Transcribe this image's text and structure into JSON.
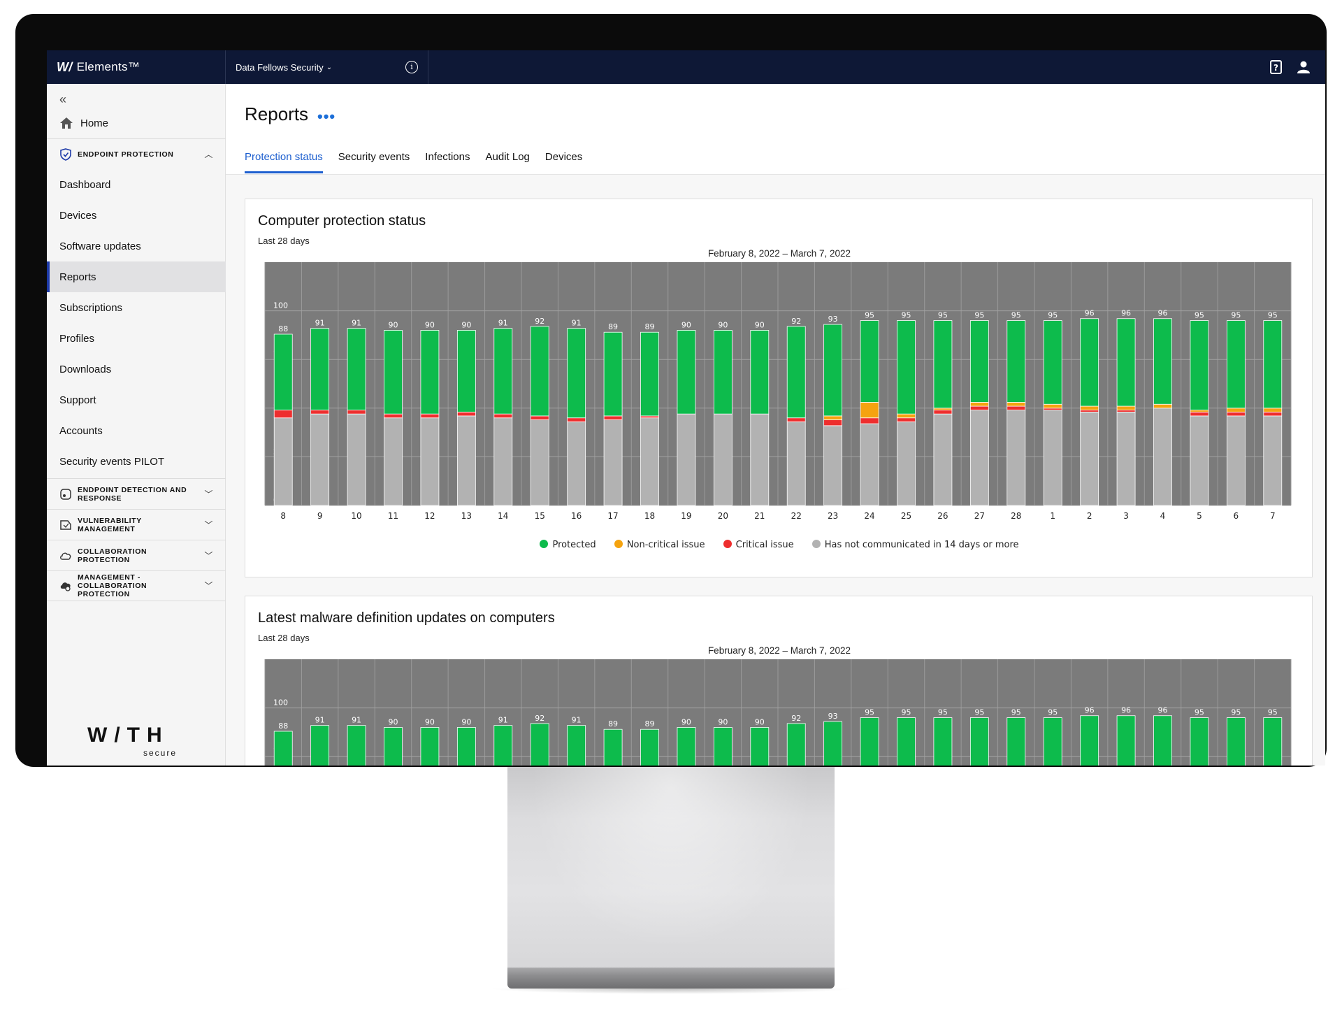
{
  "topbar": {
    "brand": "Elements™",
    "brand_mark": "W/",
    "org": "Data Fellows Security",
    "org_chevron": "⌄",
    "info": "i"
  },
  "sidebar": {
    "collapse": "«",
    "home": "Home",
    "endpoint_protection": "ENDPOINT PROTECTION",
    "items": [
      "Dashboard",
      "Devices",
      "Software updates",
      "Reports",
      "Subscriptions",
      "Profiles",
      "Downloads",
      "Support",
      "Accounts",
      "Security events PILOT"
    ],
    "sections": [
      "ENDPOINT DETECTION AND RESPONSE",
      "VULNERABILITY MANAGEMENT",
      "COLLABORATION PROTECTION",
      "MANAGEMENT - COLLABORATION PROTECTION"
    ],
    "logo": "W/TH",
    "logo_sub": "secure"
  },
  "main": {
    "title": "Reports",
    "more": "•••",
    "tabs": [
      "Protection status",
      "Security events",
      "Infections",
      "Audit Log",
      "Devices"
    ],
    "active_tab": "Protection status"
  },
  "colors": {
    "protected": "#0dbb4c",
    "non_critical": "#f5a30f",
    "critical": "#ee2e2e",
    "not_communicated": "#b2b2b2",
    "plot_bg": "#7b7b7b",
    "accent": "#1d5fcf",
    "topbar": "#0e1836"
  },
  "chart_data": [
    {
      "type": "bar",
      "stacked": true,
      "title": "Computer protection status",
      "subtitle": "Last 28 days",
      "range": "February 8, 2022 – March 7, 2022",
      "categories": [
        "8",
        "9",
        "10",
        "11",
        "12",
        "13",
        "14",
        "15",
        "16",
        "17",
        "18",
        "19",
        "20",
        "21",
        "22",
        "23",
        "24",
        "25",
        "26",
        "27",
        "28",
        "1",
        "2",
        "3",
        "4",
        "5",
        "6",
        "7"
      ],
      "totals": [
        88,
        91,
        91,
        90,
        90,
        90,
        91,
        92,
        91,
        89,
        89,
        90,
        90,
        90,
        92,
        93,
        95,
        95,
        95,
        95,
        95,
        95,
        96,
        96,
        96,
        95,
        95,
        95
      ],
      "ylim": [
        0,
        125
      ],
      "yticks": [
        0,
        25,
        50,
        75,
        100
      ],
      "series": [
        {
          "name": "Has not communicated in 14 days or more",
          "color": "#b2b2b2",
          "values": [
            45,
            47,
            47,
            45,
            45,
            46,
            45,
            44,
            43,
            44,
            45,
            47,
            47,
            47,
            43,
            41,
            42,
            43,
            47,
            49,
            49,
            49,
            48,
            48,
            50,
            46,
            46,
            46
          ]
        },
        {
          "name": "Critical issue",
          "color": "#ee2e2e",
          "values": [
            4,
            2,
            2,
            2,
            2,
            2,
            2,
            2,
            2,
            2,
            1,
            0,
            0,
            0,
            2,
            3,
            3,
            2,
            2,
            2,
            2,
            1,
            1,
            1,
            0,
            2,
            2,
            2
          ]
        },
        {
          "name": "Non-critical issue",
          "color": "#f5a30f",
          "values": [
            0,
            0,
            0,
            0,
            0,
            0,
            0,
            0,
            0,
            0,
            0,
            0,
            0,
            0,
            0,
            2,
            8,
            2,
            1,
            2,
            2,
            2,
            2,
            2,
            2,
            1,
            2,
            2
          ]
        },
        {
          "name": "Protected",
          "color": "#0dbb4c",
          "values": [
            39,
            42,
            42,
            43,
            43,
            42,
            44,
            46,
            46,
            43,
            43,
            43,
            43,
            43,
            47,
            47,
            42,
            48,
            45,
            42,
            42,
            43,
            45,
            45,
            44,
            46,
            45,
            45
          ]
        }
      ],
      "legend": [
        "Protected",
        "Non-critical issue",
        "Critical issue",
        "Has not communicated in 14 days or more"
      ]
    },
    {
      "type": "bar",
      "title": "Latest malware definition updates on computers",
      "subtitle": "Last 28 days",
      "range": "February 8, 2022 – March 7, 2022",
      "categories": [
        "8",
        "9",
        "10",
        "11",
        "12",
        "13",
        "14",
        "15",
        "16",
        "17",
        "18",
        "19",
        "20",
        "21",
        "22",
        "23",
        "24",
        "25",
        "26",
        "27",
        "28",
        "1",
        "2",
        "3",
        "4",
        "5",
        "6",
        "7"
      ],
      "values": [
        88,
        91,
        91,
        90,
        90,
        90,
        91,
        92,
        91,
        89,
        89,
        90,
        90,
        90,
        92,
        93,
        95,
        95,
        95,
        95,
        95,
        95,
        96,
        96,
        96,
        95,
        95,
        95
      ],
      "ylim": [
        0,
        125
      ],
      "yticks": [
        75,
        100
      ],
      "color": "#0dbb4c"
    }
  ]
}
